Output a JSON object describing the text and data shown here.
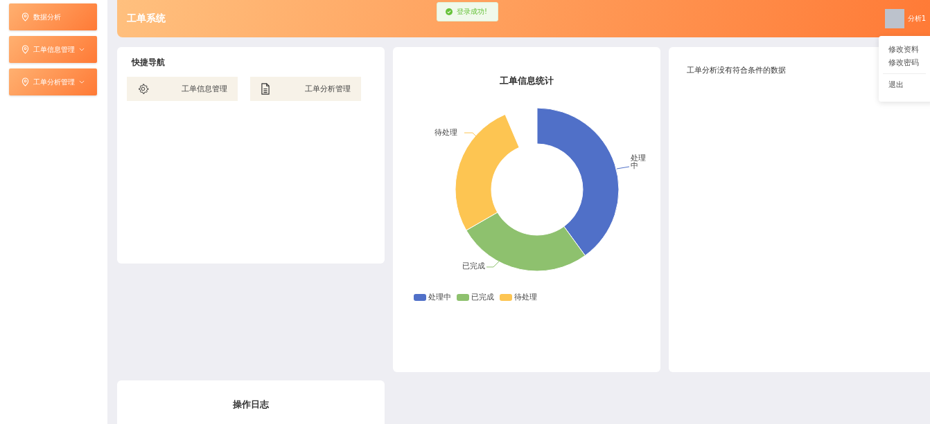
{
  "sidebar": {
    "items": [
      {
        "label": "数据分析",
        "expandable": false
      },
      {
        "label": "工单信息管理",
        "expandable": true
      },
      {
        "label": "工单分析管理",
        "expandable": true
      }
    ]
  },
  "header": {
    "title": "工单系统",
    "user": "分析1"
  },
  "toast": {
    "message": "登录成功!"
  },
  "user_menu": {
    "items": [
      "修改资料",
      "修改密码"
    ],
    "logout": "退出"
  },
  "quick_nav": {
    "title": "快捷导航",
    "items": [
      {
        "label": "工单信息管理",
        "kind": "settings"
      },
      {
        "label": "工单分析管理",
        "kind": "document"
      }
    ]
  },
  "stats_card": {
    "title": "工单信息统计",
    "donut": [
      {
        "label": "处理中",
        "color": "#5070c8"
      },
      {
        "label": "已完成",
        "color": "#8ec16e"
      },
      {
        "label": "待处理",
        "color": "#fdc552"
      }
    ],
    "legend": [
      {
        "label": "处理中",
        "color": "#5070c8"
      },
      {
        "label": "已完成",
        "color": "#8ec16e"
      },
      {
        "label": "待处理",
        "color": "#fdc552"
      }
    ]
  },
  "analysis_card": {
    "message": "工单分析没有符合条件的数据"
  },
  "log_card": {
    "title": "操作日志"
  }
}
